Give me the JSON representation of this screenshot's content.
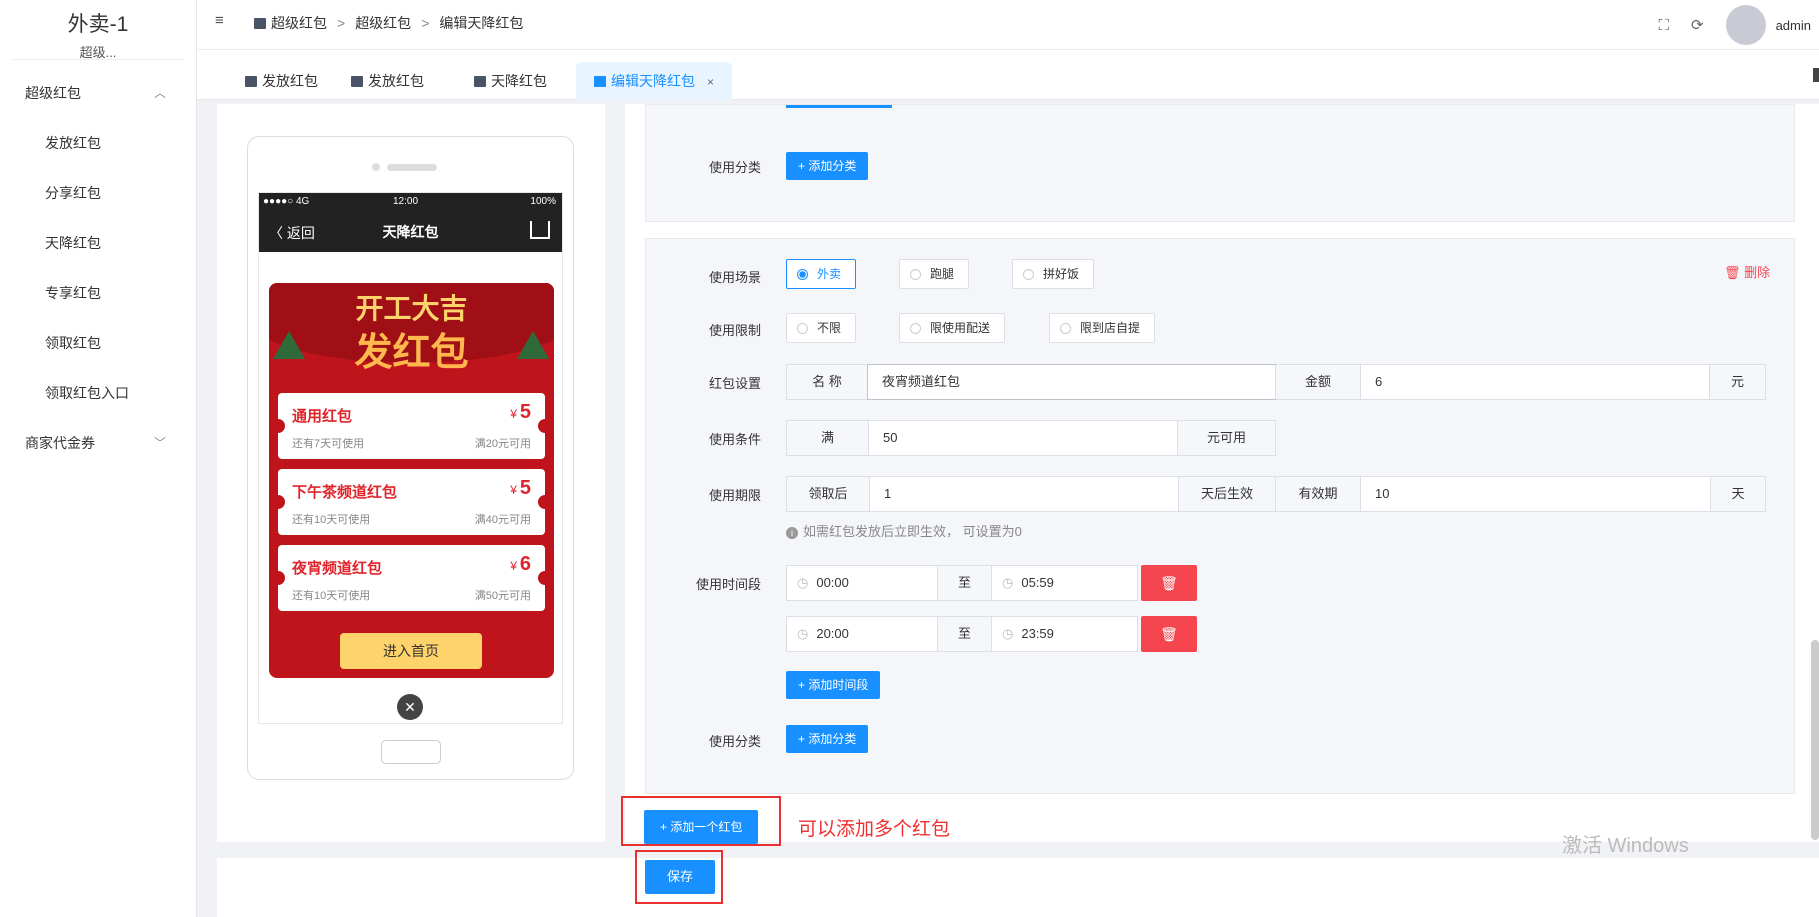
{
  "sidebar": {
    "brand_title": "外卖-1",
    "brand_sub": "超级...",
    "group1": "超级红包",
    "items": [
      "发放红包",
      "分享红包",
      "天降红包",
      "专享红包",
      "领取红包",
      "领取红包入口"
    ],
    "group2": "商家代金券"
  },
  "header": {
    "fold_icon": "≡",
    "breadcrumb": [
      "超级红包",
      "超级红包",
      "编辑天降红包"
    ],
    "separator": ">",
    "username": "admin"
  },
  "tabs": [
    {
      "label": "发放红包"
    },
    {
      "label": "发放红包"
    },
    {
      "label": "天降红包"
    },
    {
      "label": "编辑天降红包",
      "close": "×"
    }
  ],
  "phone": {
    "status_left": "●●●●○ 4G",
    "status_time": "12:00",
    "status_right": "100%",
    "back": "〈 返回",
    "title": "天降红包",
    "headline1": "开工大吉",
    "headline2": "发红包",
    "coupons": [
      {
        "name": "通用红包",
        "yen": "¥",
        "amount": "5",
        "expire": "还有7天可使用",
        "cond": "满20元可用"
      },
      {
        "name": "下午茶频道红包",
        "yen": "¥",
        "amount": "5",
        "expire": "还有10天可使用",
        "cond": "满40元可用"
      },
      {
        "name": "夜宵频道红包",
        "yen": "¥",
        "amount": "6",
        "expire": "还有10天可使用",
        "cond": "满50元可用"
      }
    ],
    "enter_btn": "进入首页",
    "close": "✕"
  },
  "section1": {
    "label_category": "使用分类",
    "add_category": "+ 添加分类"
  },
  "section2": {
    "delete": "删除",
    "label_scene": "使用场景",
    "scenes": [
      "外卖",
      "跑腿",
      "拼好饭"
    ],
    "label_limit": "使用限制",
    "limits": [
      "不限",
      "限使用配送",
      "限到店自提"
    ],
    "label_setting": "红包设置",
    "name_addon": "名 称",
    "name_value": "夜宵频道红包",
    "amount_addon": "金额",
    "amount_value": "6",
    "amount_unit": "元",
    "label_condition": "使用条件",
    "cond_pre": "满",
    "cond_value": "50",
    "cond_post": "元可用",
    "label_period": "使用期限",
    "period_pre": "领取后",
    "period_value": "1",
    "period_mid": "天后生效",
    "valid_addon": "有效期",
    "valid_value": "10",
    "valid_unit": "天",
    "hint": "如需红包发放后立即生效， 可设置为0",
    "label_time": "使用时间段",
    "times": [
      {
        "start": "00:00",
        "to": "至",
        "end": "05:59"
      },
      {
        "start": "20:00",
        "to": "至",
        "end": "23:59"
      }
    ],
    "add_time": "+ 添加时间段",
    "label_category": "使用分类",
    "add_category": "+ 添加分类"
  },
  "add_packet": "+ 添加一个红包",
  "note": "可以添加多个红包",
  "save": "保存",
  "watermark": "激活 Windows"
}
